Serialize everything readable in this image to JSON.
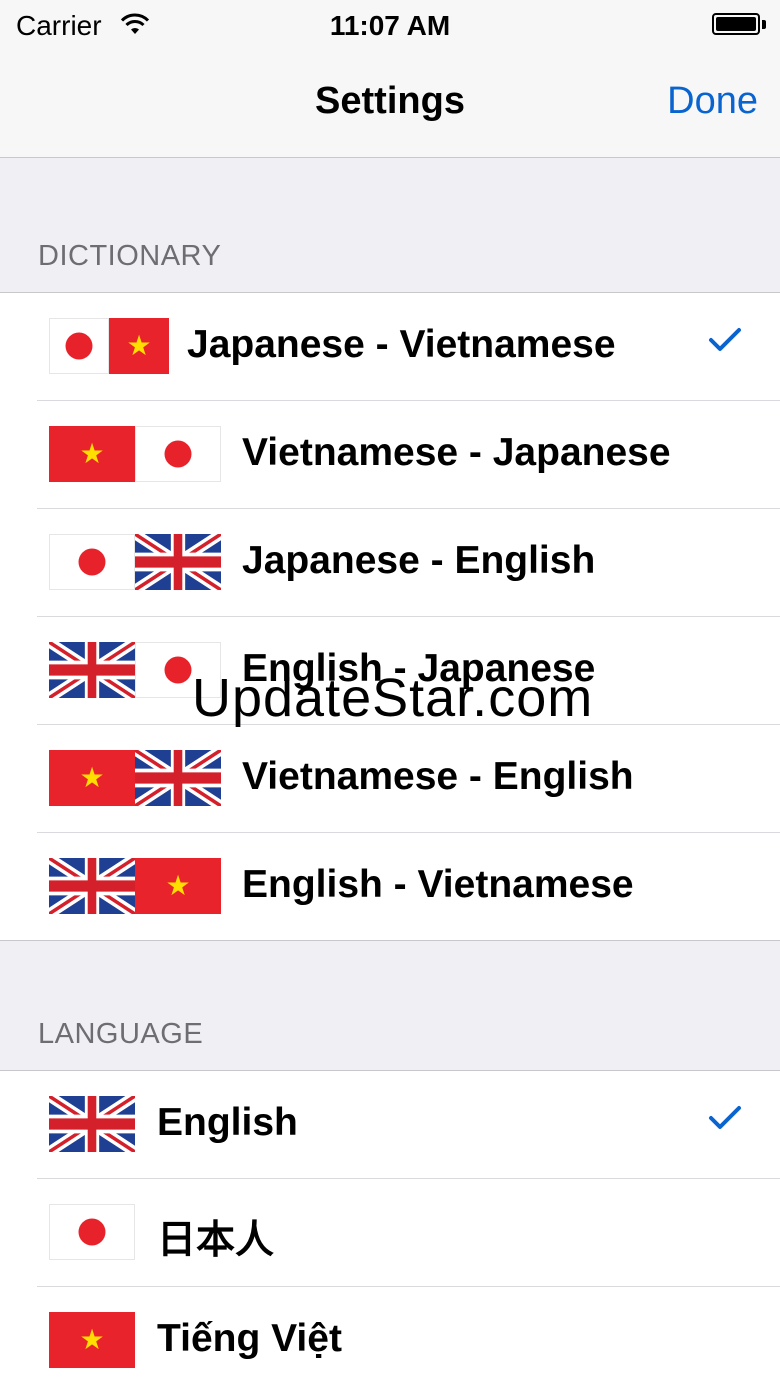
{
  "status": {
    "carrier": "Carrier",
    "time": "11:07 AM"
  },
  "nav": {
    "title": "Settings",
    "done_label": "Done"
  },
  "dictionary": {
    "header": "DICTIONARY",
    "items": [
      {
        "label": "Japanese - Vietnamese",
        "flags": [
          "jp",
          "vn"
        ],
        "selected": true
      },
      {
        "label": "Vietnamese - Japanese",
        "flags": [
          "vn",
          "jp"
        ],
        "selected": false
      },
      {
        "label": "Japanese - English",
        "flags": [
          "jp",
          "uk"
        ],
        "selected": false
      },
      {
        "label": "English - Japanese",
        "flags": [
          "uk",
          "jp"
        ],
        "selected": false
      },
      {
        "label": "Vietnamese - English",
        "flags": [
          "vn",
          "uk"
        ],
        "selected": false
      },
      {
        "label": "English - Vietnamese",
        "flags": [
          "uk",
          "vn"
        ],
        "selected": false
      }
    ]
  },
  "language": {
    "header": "LANGUAGE",
    "items": [
      {
        "label": "English",
        "flags": [
          "uk"
        ],
        "selected": true
      },
      {
        "label": "日本人",
        "flags": [
          "jp"
        ],
        "selected": false
      },
      {
        "label": "Tiếng Việt",
        "flags": [
          "vn"
        ],
        "selected": false
      }
    ]
  },
  "watermark": "UpdateStar.com",
  "colors": {
    "accent": "#0a64d0",
    "flag_red": "#e9232b",
    "star_yellow": "#ffde00",
    "uk_blue": "#1f3f93"
  }
}
